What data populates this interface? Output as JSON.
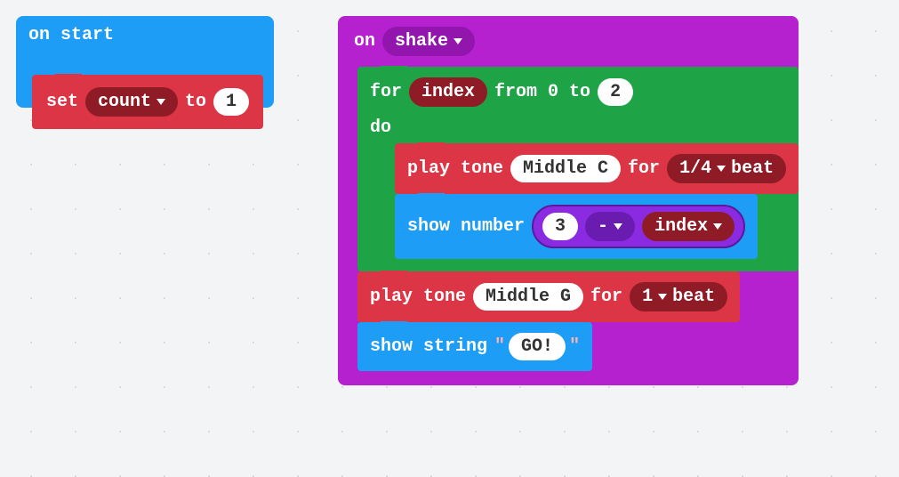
{
  "colors": {
    "event_blue": "#1e9df7",
    "event_purple": "#b520cf",
    "variable_red": "#dc3545",
    "loop_green": "#1fa347",
    "music_red": "#dc3545",
    "basic_blue": "#1e9df7",
    "math_purple": "#8a2be2"
  },
  "stack1": {
    "hat": {
      "label": "on start"
    },
    "set": {
      "kw_set": "set",
      "var": "count",
      "kw_to": "to",
      "value": "1"
    }
  },
  "stack2": {
    "hat": {
      "kw_on": "on",
      "gesture": "shake"
    },
    "for": {
      "kw_for": "for",
      "var": "index",
      "kw_from": "from 0 to",
      "to": "2",
      "kw_do": "do"
    },
    "playTone1": {
      "kw_play": "play tone",
      "note": "Middle C",
      "kw_for": "for",
      "beat": "1/4",
      "kw_beat": "beat"
    },
    "showNumber": {
      "kw": "show number",
      "left": "3",
      "op": "-",
      "right_var": "index"
    },
    "playTone2": {
      "kw_play": "play tone",
      "note": "Middle G",
      "kw_for": "for",
      "beat": "1",
      "kw_beat": "beat"
    },
    "showString": {
      "kw": "show string",
      "q1": "\"",
      "value": "GO!",
      "q2": "\""
    }
  }
}
